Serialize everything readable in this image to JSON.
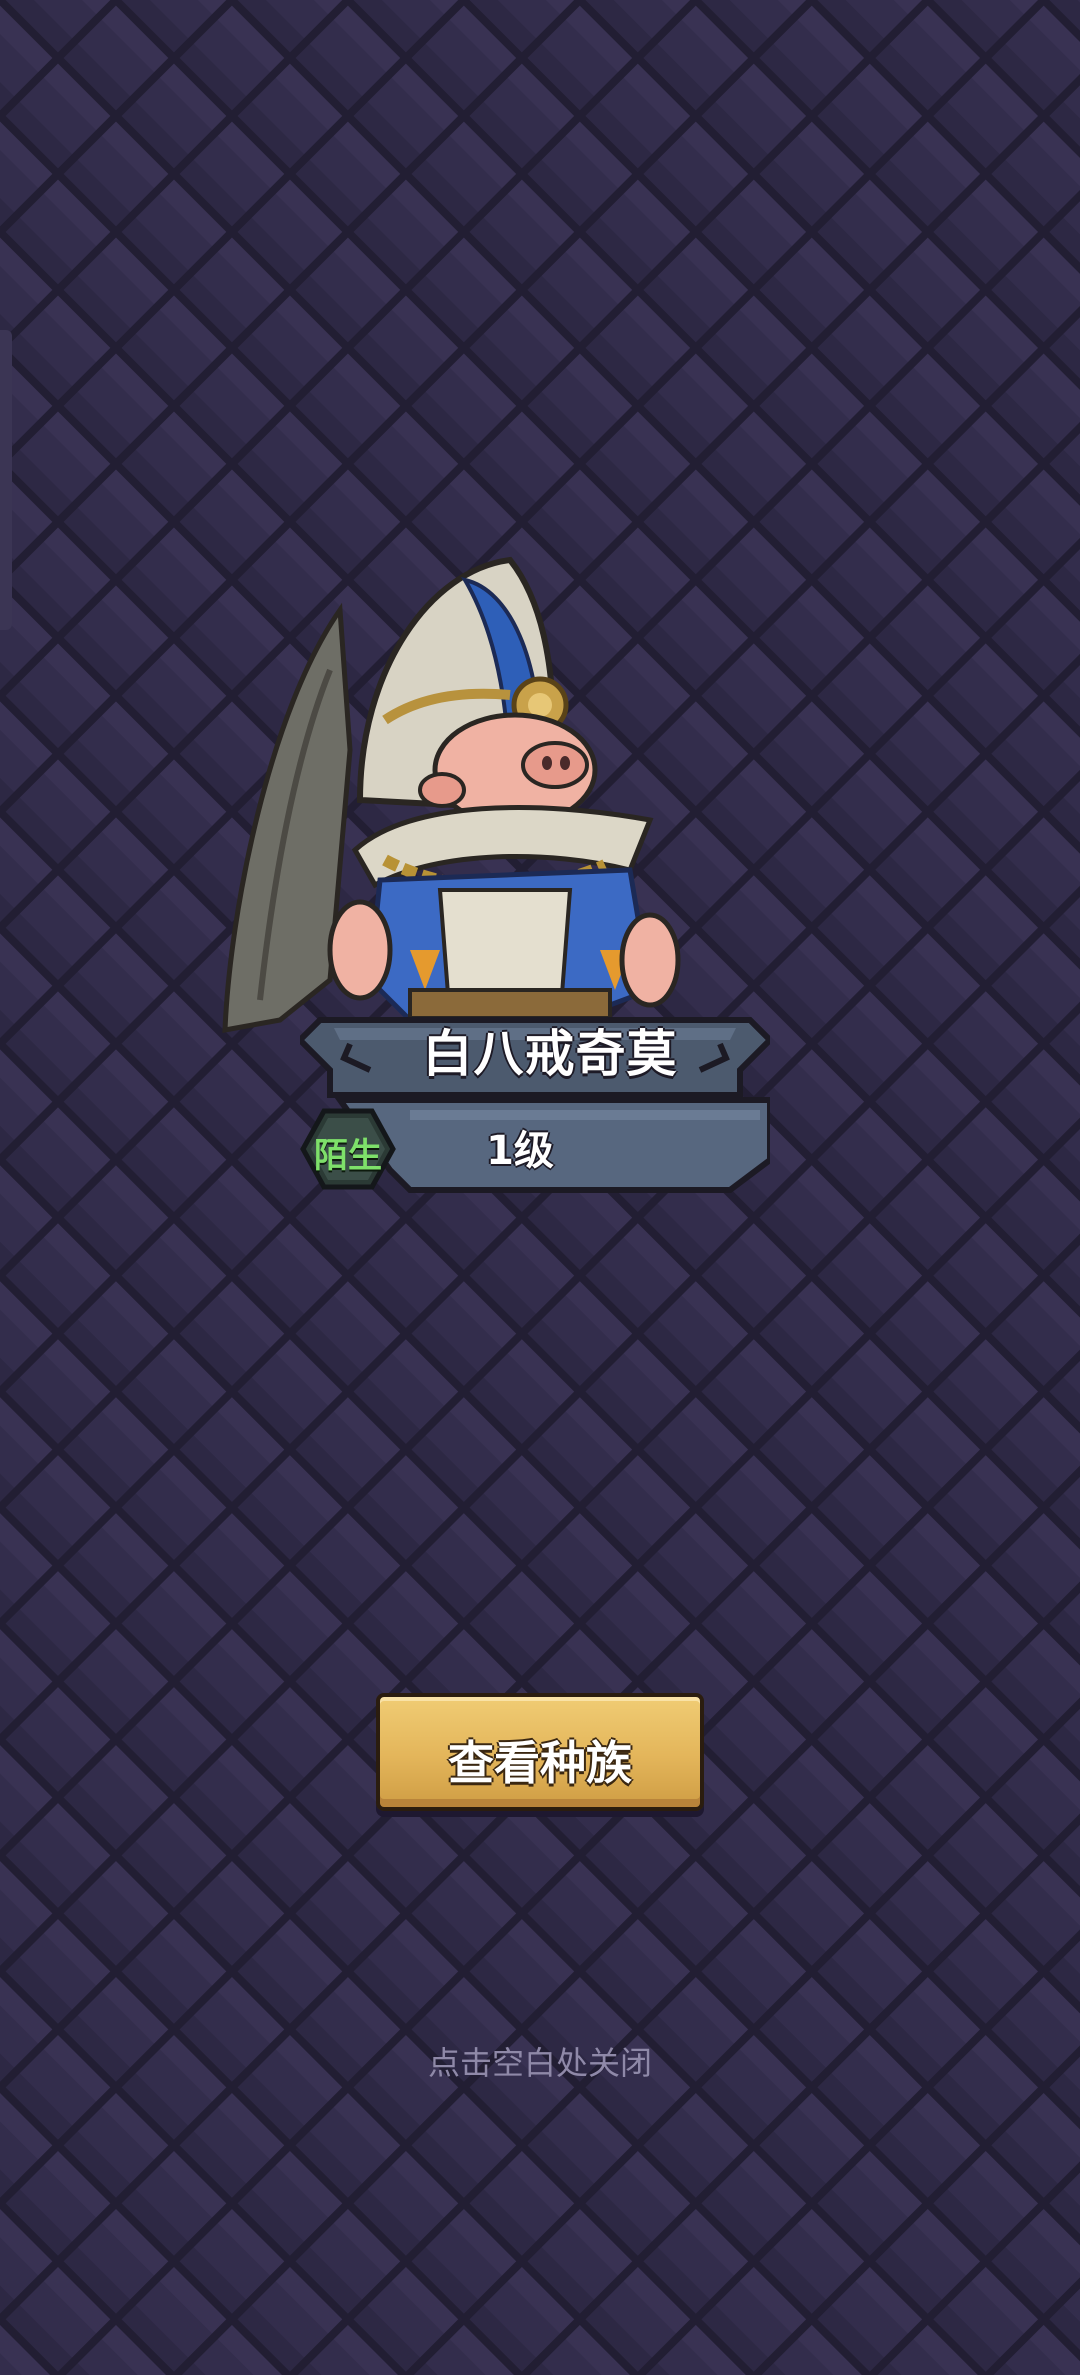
{
  "hero": {
    "name": "白八戒奇莫",
    "level": "1级",
    "relation": "陌生"
  },
  "actions": {
    "view_race_label": "查看种族"
  },
  "hint": {
    "close_text": "点击空白处关闭"
  },
  "colors": {
    "background": "#2f2a47",
    "tile_light": "#3a3456",
    "tile_dark": "#221e33",
    "button_gold": "#e3b55a",
    "relation_green": "#7ee06a"
  },
  "icons": {
    "character": "pig-priest-character",
    "relation": "hexagon-badge"
  }
}
